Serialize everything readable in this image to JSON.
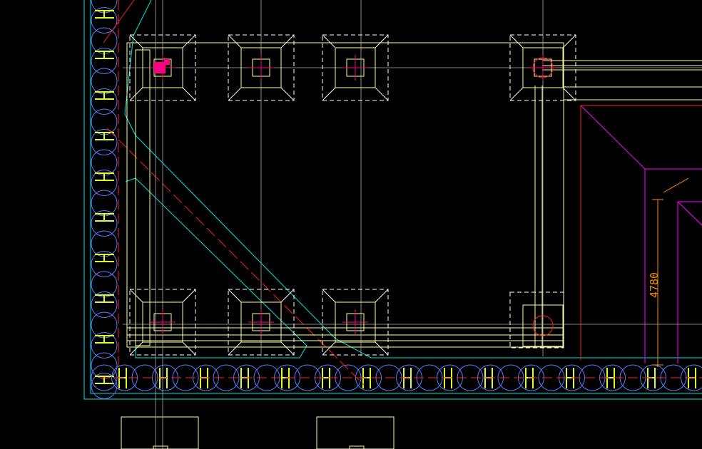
{
  "drawing": {
    "background": "#000000",
    "colors": {
      "white_line": "#FFFFFF",
      "yellow_line": "#FFFF99",
      "cyan_line": "#00FFFF",
      "red_line": "#FF2020",
      "magenta_line": "#FF00FF",
      "pile_circle": "#5A7CFF",
      "brace_yellow": "#DDFF22",
      "gray_line": "#BBBBBB",
      "column_pink": "#FF0080",
      "dim_orange": "#FF8C00"
    },
    "dimension": {
      "label": "4780",
      "color": "#FF8C00"
    }
  }
}
